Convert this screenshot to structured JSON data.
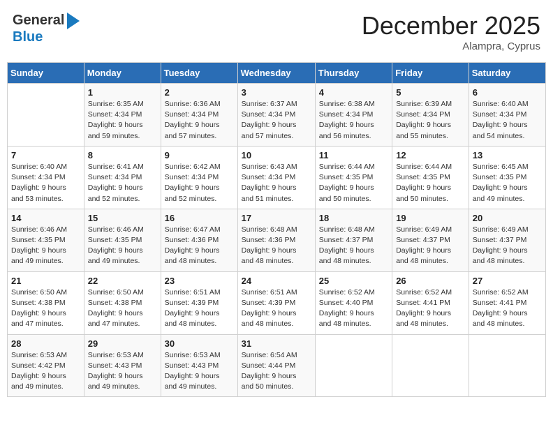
{
  "logo": {
    "general": "General",
    "blue": "Blue"
  },
  "header": {
    "month": "December 2025",
    "location": "Alampra, Cyprus"
  },
  "weekdays": [
    "Sunday",
    "Monday",
    "Tuesday",
    "Wednesday",
    "Thursday",
    "Friday",
    "Saturday"
  ],
  "weeks": [
    [
      {
        "num": "",
        "info": ""
      },
      {
        "num": "1",
        "info": "Sunrise: 6:35 AM\nSunset: 4:34 PM\nDaylight: 9 hours\nand 59 minutes."
      },
      {
        "num": "2",
        "info": "Sunrise: 6:36 AM\nSunset: 4:34 PM\nDaylight: 9 hours\nand 57 minutes."
      },
      {
        "num": "3",
        "info": "Sunrise: 6:37 AM\nSunset: 4:34 PM\nDaylight: 9 hours\nand 57 minutes."
      },
      {
        "num": "4",
        "info": "Sunrise: 6:38 AM\nSunset: 4:34 PM\nDaylight: 9 hours\nand 56 minutes."
      },
      {
        "num": "5",
        "info": "Sunrise: 6:39 AM\nSunset: 4:34 PM\nDaylight: 9 hours\nand 55 minutes."
      },
      {
        "num": "6",
        "info": "Sunrise: 6:40 AM\nSunset: 4:34 PM\nDaylight: 9 hours\nand 54 minutes."
      }
    ],
    [
      {
        "num": "7",
        "info": "Sunrise: 6:40 AM\nSunset: 4:34 PM\nDaylight: 9 hours\nand 53 minutes."
      },
      {
        "num": "8",
        "info": "Sunrise: 6:41 AM\nSunset: 4:34 PM\nDaylight: 9 hours\nand 52 minutes."
      },
      {
        "num": "9",
        "info": "Sunrise: 6:42 AM\nSunset: 4:34 PM\nDaylight: 9 hours\nand 52 minutes."
      },
      {
        "num": "10",
        "info": "Sunrise: 6:43 AM\nSunset: 4:34 PM\nDaylight: 9 hours\nand 51 minutes."
      },
      {
        "num": "11",
        "info": "Sunrise: 6:44 AM\nSunset: 4:35 PM\nDaylight: 9 hours\nand 50 minutes."
      },
      {
        "num": "12",
        "info": "Sunrise: 6:44 AM\nSunset: 4:35 PM\nDaylight: 9 hours\nand 50 minutes."
      },
      {
        "num": "13",
        "info": "Sunrise: 6:45 AM\nSunset: 4:35 PM\nDaylight: 9 hours\nand 49 minutes."
      }
    ],
    [
      {
        "num": "14",
        "info": "Sunrise: 6:46 AM\nSunset: 4:35 PM\nDaylight: 9 hours\nand 49 minutes."
      },
      {
        "num": "15",
        "info": "Sunrise: 6:46 AM\nSunset: 4:35 PM\nDaylight: 9 hours\nand 49 minutes."
      },
      {
        "num": "16",
        "info": "Sunrise: 6:47 AM\nSunset: 4:36 PM\nDaylight: 9 hours\nand 48 minutes."
      },
      {
        "num": "17",
        "info": "Sunrise: 6:48 AM\nSunset: 4:36 PM\nDaylight: 9 hours\nand 48 minutes."
      },
      {
        "num": "18",
        "info": "Sunrise: 6:48 AM\nSunset: 4:37 PM\nDaylight: 9 hours\nand 48 minutes."
      },
      {
        "num": "19",
        "info": "Sunrise: 6:49 AM\nSunset: 4:37 PM\nDaylight: 9 hours\nand 48 minutes."
      },
      {
        "num": "20",
        "info": "Sunrise: 6:49 AM\nSunset: 4:37 PM\nDaylight: 9 hours\nand 48 minutes."
      }
    ],
    [
      {
        "num": "21",
        "info": "Sunrise: 6:50 AM\nSunset: 4:38 PM\nDaylight: 9 hours\nand 47 minutes."
      },
      {
        "num": "22",
        "info": "Sunrise: 6:50 AM\nSunset: 4:38 PM\nDaylight: 9 hours\nand 47 minutes."
      },
      {
        "num": "23",
        "info": "Sunrise: 6:51 AM\nSunset: 4:39 PM\nDaylight: 9 hours\nand 48 minutes."
      },
      {
        "num": "24",
        "info": "Sunrise: 6:51 AM\nSunset: 4:39 PM\nDaylight: 9 hours\nand 48 minutes."
      },
      {
        "num": "25",
        "info": "Sunrise: 6:52 AM\nSunset: 4:40 PM\nDaylight: 9 hours\nand 48 minutes."
      },
      {
        "num": "26",
        "info": "Sunrise: 6:52 AM\nSunset: 4:41 PM\nDaylight: 9 hours\nand 48 minutes."
      },
      {
        "num": "27",
        "info": "Sunrise: 6:52 AM\nSunset: 4:41 PM\nDaylight: 9 hours\nand 48 minutes."
      }
    ],
    [
      {
        "num": "28",
        "info": "Sunrise: 6:53 AM\nSunset: 4:42 PM\nDaylight: 9 hours\nand 49 minutes."
      },
      {
        "num": "29",
        "info": "Sunrise: 6:53 AM\nSunset: 4:43 PM\nDaylight: 9 hours\nand 49 minutes."
      },
      {
        "num": "30",
        "info": "Sunrise: 6:53 AM\nSunset: 4:43 PM\nDaylight: 9 hours\nand 49 minutes."
      },
      {
        "num": "31",
        "info": "Sunrise: 6:54 AM\nSunset: 4:44 PM\nDaylight: 9 hours\nand 50 minutes."
      },
      {
        "num": "",
        "info": ""
      },
      {
        "num": "",
        "info": ""
      },
      {
        "num": "",
        "info": ""
      }
    ]
  ]
}
